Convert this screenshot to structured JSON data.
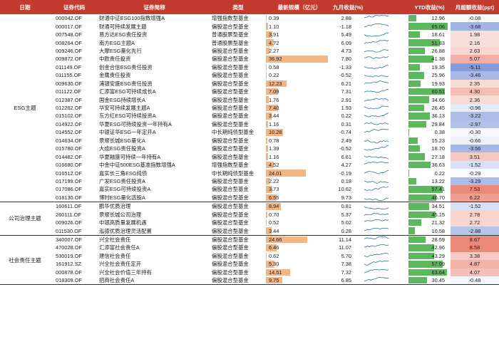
{
  "headers": {
    "date": "日期",
    "code": "证券代码",
    "name": "证券简称",
    "type": "类型",
    "size": "最新规模（亿元）",
    "sep_return": "九月收益(%)",
    "trend": "",
    "ytd": "YTD收益(%)",
    "excess": "月超额收益(ppt)"
  },
  "colors": {
    "header_bg": "#c23b2e",
    "size_bar": "#f3b583",
    "ytd_bar": "#5cb85c",
    "excess_positive": "#e8735f",
    "excess_negative": "#5a7bd1",
    "sparkline": "#2d6fb8"
  },
  "groups": [
    {
      "theme": "ESG主题",
      "rows": [
        {
          "code": "000042.OF",
          "name": "财通中证ESG100指数增强A",
          "type": "增强指数型基金",
          "size": "0.39",
          "sep": "2.88",
          "ytd": "12.96",
          "excess": "-0.08"
        },
        {
          "code": "000017.OF",
          "name": "财通可持续发展主题",
          "type": "偏股混合型基金",
          "size": "1.10",
          "sep": "-1.18",
          "ytd": "65.06",
          "excess": "-3.68"
        },
        {
          "code": "007548.OF",
          "name": "易方达ESG责任投资",
          "type": "普通股票型基金",
          "size": "3.91",
          "sep": "5.49",
          "ytd": "18.61",
          "excess": "1.98"
        },
        {
          "code": "008264.OF",
          "name": "南方ESG主题A",
          "type": "普通股票型基金",
          "size": "4.72",
          "sep": "6.09",
          "ytd": "51.83",
          "excess": "2.16"
        },
        {
          "code": "009246.OF",
          "name": "大摩ESG量化先行",
          "type": "偏股混合型基金",
          "size": "2.27",
          "sep": "4.73",
          "ytd": "26.88",
          "excess": "2.63"
        },
        {
          "code": "009872.OF",
          "name": "中欧责任投资",
          "type": "偏股混合型基金",
          "size": "36.92",
          "sep": "7.80",
          "ytd": "41.38",
          "excess": "5.07"
        },
        {
          "code": "011149.OF",
          "name": "创金合信ESG责任投资",
          "type": "偏股混合型基金",
          "size": "0.58",
          "sep": "-1.33",
          "ytd": "19.35",
          "excess": "-5.11"
        },
        {
          "code": "011155.OF",
          "name": "金鹰责任投资",
          "type": "偏股混合型基金",
          "size": "0.22",
          "sep": "-0.52",
          "ytd": "25.96",
          "excess": "-3.46"
        },
        {
          "code": "009630.OF",
          "name": "浦银安盛ESG责任投资",
          "type": "偏股混合型基金",
          "size": "12.23",
          "sep": "6.21",
          "ytd": "19.93",
          "excess": "2.35"
        },
        {
          "code": "011122.OF",
          "name": "汇添富ESG可持续成长A",
          "type": "偏股混合型基金",
          "size": "7.09",
          "sep": "7.31",
          "ytd": "60.51",
          "excess": "4.30"
        },
        {
          "code": "012387.OF",
          "name": "国金ESG持续增长A",
          "type": "偏股混合型基金",
          "size": "1.76",
          "sep": "2.91",
          "ytd": "34.66",
          "excess": "2.36"
        },
        {
          "code": "012262.OF",
          "name": "华安可持续发展主题A",
          "type": "偏股混合型基金",
          "size": "7.40",
          "sep": "1.93",
          "ytd": "26.45",
          "excess": "-0.96"
        },
        {
          "code": "015102.OF",
          "name": "东方红ESG可持续投资A",
          "type": "偏股混合型基金",
          "size": "3.44",
          "sep": "0.22",
          "ytd": "36.13",
          "excess": "-3.22"
        },
        {
          "code": "014922.OF",
          "name": "华夏ESG可持续投资一年持有A",
          "type": "偏股混合型基金",
          "size": "1.16",
          "sep": "0.31",
          "ytd": "29.84",
          "excess": "-2.97"
        },
        {
          "code": "014552.OF",
          "name": "中银证华ESG一年定开A",
          "type": "中长期纯债型基金",
          "size": "10.28",
          "sep": "-0.74",
          "ytd": "0.38",
          "excess": "-0.30"
        },
        {
          "code": "014634.OF",
          "name": "景顺长城ESG量化A",
          "type": "偏股混合型基金",
          "size": "0.78",
          "sep": "2.49",
          "ytd": "15.23",
          "excess": "-0.66"
        },
        {
          "code": "015780.OF",
          "name": "大成ESG责任投资A",
          "type": "偏股混合型基金",
          "size": "1.39",
          "sep": "-0.52",
          "ytd": "18.70",
          "excess": "-3.56"
        },
        {
          "code": "014482.OF",
          "name": "华夏融盛可持续一年持有A",
          "type": "偏股混合型基金",
          "size": "1.16",
          "sep": "6.61",
          "ytd": "27.18",
          "excess": "3.51"
        },
        {
          "code": "016680.OF",
          "name": "中金中证500ESG基准指数增强A",
          "type": "增强指数型基金",
          "size": "4.52",
          "sep": "4.27",
          "ytd": "36.63",
          "excess": "-1.52"
        },
        {
          "code": "016512.OF",
          "name": "嘉实长三角ESG纯债",
          "type": "中长期纯债型基金",
          "size": "24.01",
          "sep": "-0.19",
          "ytd": "0.22",
          "excess": "-0.29"
        },
        {
          "code": "017199.OF",
          "name": "广发ESG责任投资A",
          "type": "偏股混合型基金",
          "size": "2.22",
          "sep": "0.18",
          "ytd": "13.22",
          "excess": "-3.29"
        },
        {
          "code": "017086.OF",
          "name": "嘉实ESG可持续投资A",
          "type": "偏股混合型基金",
          "size": "3.73",
          "sep": "10.62",
          "ytd": "57.41",
          "excess": "7.53"
        },
        {
          "code": "018130.OF",
          "name": "博时ESG量化选股A",
          "type": "偏股混合型基金",
          "size": "6.55",
          "sep": "9.73",
          "ytd": "46.70",
          "excess": "6.22"
        }
      ]
    },
    {
      "theme": "公司治理主题",
      "rows": [
        {
          "code": "160611.OF",
          "name": "鹏华优质治理",
          "type": "偏股混合型基金",
          "size": "8.94",
          "sep": "0.81",
          "ytd": "34.51",
          "excess": "-1.52"
        },
        {
          "code": "260111.OF",
          "name": "景顺长城公司治理",
          "type": "偏股混合型基金",
          "size": "0.70",
          "sep": "5.37",
          "ytd": "45.15",
          "excess": "2.78"
        },
        {
          "code": "009026.OF",
          "name": "中银高质量发展机遇",
          "type": "偏股混合型基金",
          "size": "0.52",
          "sep": "5.02",
          "ytd": "21.32",
          "excess": "2.72"
        },
        {
          "code": "011530.OF",
          "name": "泓德优质治理灵活配置",
          "type": "偏股混合型基金",
          "size": "3.44",
          "sep": "0.28",
          "ytd": "10.58",
          "excess": "-2.88"
        }
      ]
    },
    {
      "theme": "社会责任主题",
      "rows": [
        {
          "code": "340007.OF",
          "name": "兴全社会责任",
          "type": "偏股混合型基金",
          "size": "24.66",
          "sep": "11.14",
          "ytd": "28.59",
          "excess": "8.67"
        },
        {
          "code": "470028.OF",
          "name": "汇添富社会责任A",
          "type": "偏股混合型基金",
          "size": "6.46",
          "sep": "11.07",
          "ytd": "42.96",
          "excess": "8.58"
        },
        {
          "code": "530019.OF",
          "name": "建信社会责任",
          "type": "偏股混合型基金",
          "size": "0.62",
          "sep": "5.70",
          "ytd": "43.29",
          "excess": "3.38"
        },
        {
          "code": "161912.SZ",
          "name": "兴全社会责任定开",
          "type": "偏股混合型基金",
          "size": "5.30",
          "sep": "7.38",
          "ytd": "57.09",
          "excess": "4.87"
        },
        {
          "code": "000878.OF",
          "name": "兴全社会价值三年持有",
          "type": "偏股混合型基金",
          "size": "14.51",
          "sep": "7.32",
          "ytd": "63.64",
          "excess": "4.07"
        },
        {
          "code": "018309.OF",
          "name": "招商社会责任A",
          "type": "偏股混合型基金",
          "size": "9.75",
          "sep": "6.85",
          "ytd": "30.45",
          "excess": "-0.48"
        }
      ]
    }
  ]
}
